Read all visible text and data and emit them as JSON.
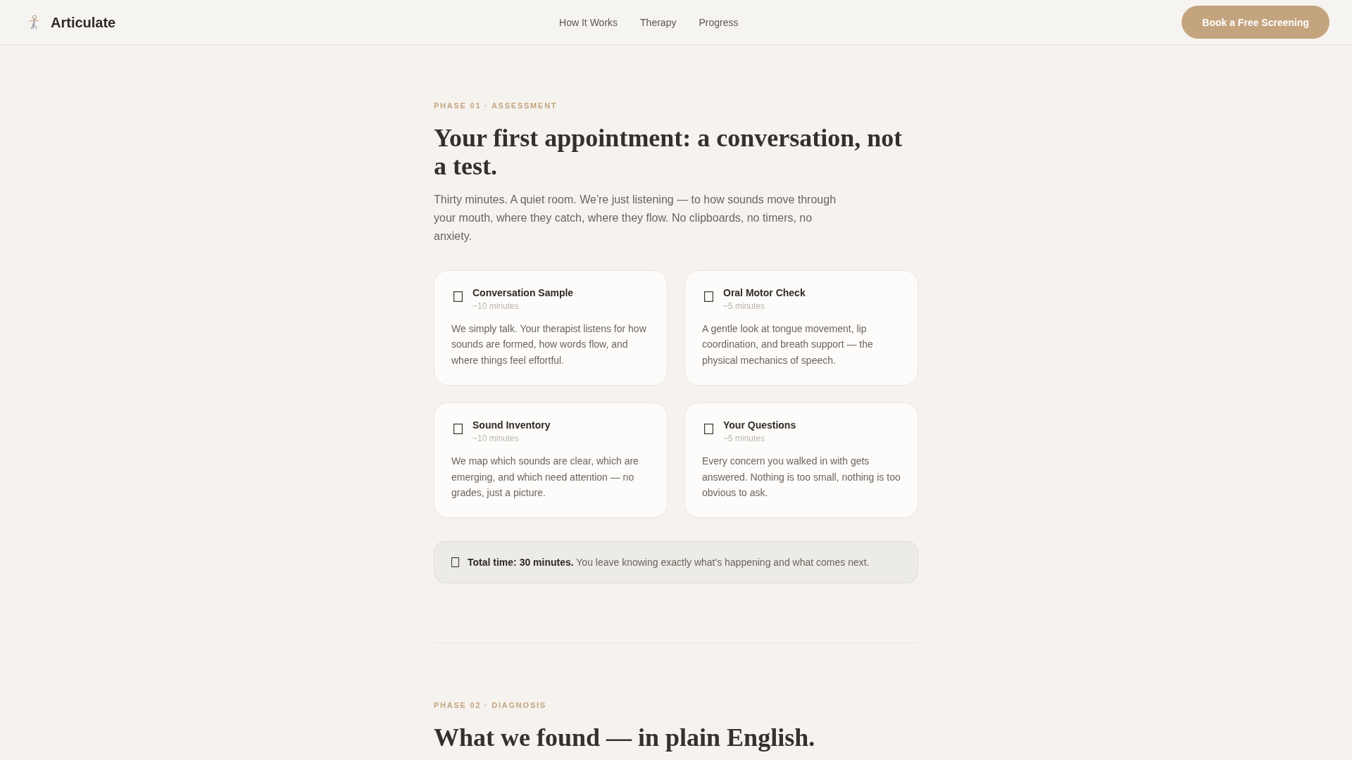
{
  "header": {
    "brand": "Articulate",
    "nav": [
      {
        "label": "How It Works"
      },
      {
        "label": "Therapy"
      },
      {
        "label": "Progress"
      }
    ],
    "cta": "Book a Free Screening"
  },
  "phases": [
    {
      "eyebrow": "PHASE 01 · ASSESSMENT",
      "title": "Your first appointment: a conversation, not a test.",
      "intro": "Thirty minutes. A quiet room. We're just listening — to how sounds move through your mouth, where they catch, where they flow. No clipboards, no timers, no anxiety.",
      "steps": [
        {
          "title": "Conversation Sample",
          "duration": "~10 minutes",
          "description": "We simply talk. Your therapist listens for how sounds are formed, how words flow, and where things feel effortful."
        },
        {
          "title": "Oral Motor Check",
          "duration": "~5 minutes",
          "description": "A gentle look at tongue movement, lip coordination, and breath support — the physical mechanics of speech."
        },
        {
          "title": "Sound Inventory",
          "duration": "~10 minutes",
          "description": "We map which sounds are clear, which are emerging, and which need attention — no grades, just a picture."
        },
        {
          "title": "Your Questions",
          "duration": "~5 minutes",
          "description": "Every concern you walked in with gets answered. Nothing is too small, nothing is too obvious to ask."
        }
      ],
      "summary": "**Total time: 30 minutes.** You leave knowing exactly what's happening and what comes next."
    },
    {
      "eyebrow": "PHASE 02 · DIAGNOSIS",
      "title": "What we found — in plain English."
    }
  ]
}
